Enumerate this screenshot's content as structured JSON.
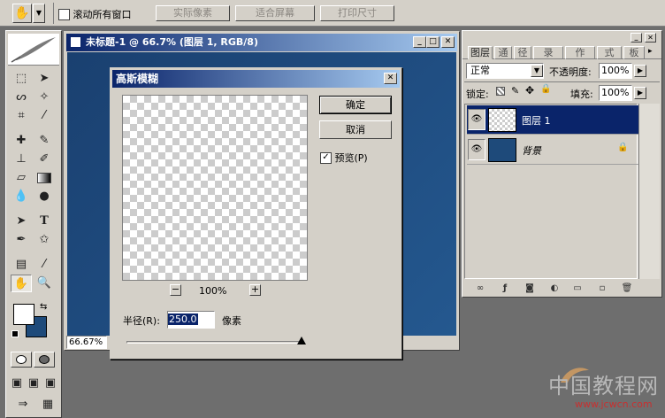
{
  "options_bar": {
    "tool_icon": "hand-icon",
    "scroll_all_windows": "滚动所有窗口",
    "actual_pixels": "实际像素",
    "fit_screen": "适合屏幕",
    "print_size": "打印尺寸"
  },
  "document": {
    "title": "未标题-1 @ 66.7% (图层 1, RGB/8)",
    "zoom_status": "66.67%"
  },
  "dialog": {
    "title": "高斯模糊",
    "ok": "确定",
    "cancel": "取消",
    "preview_label": "预览(P)",
    "preview_checked": true,
    "zoom_out": "−",
    "zoom_in": "+",
    "zoom_level": "100%",
    "radius_label": "半径(R):",
    "radius_value": "250.0",
    "radius_unit": "像素"
  },
  "layers_panel": {
    "tabs": [
      "图层",
      "通",
      "径",
      "录",
      "作",
      "式",
      "板"
    ],
    "blend_mode": "正常",
    "opacity_label": "不透明度:",
    "opacity_value": "100%",
    "lock_label": "锁定:",
    "fill_label": "填充:",
    "fill_value": "100%",
    "layers": [
      {
        "name": "图层 1",
        "selected": true
      },
      {
        "name": "背景",
        "selected": false,
        "locked": true
      }
    ]
  },
  "watermark": {
    "brand": "中国教程网",
    "url": "www.jcwcn.com"
  },
  "colors": {
    "titlebar_active": "#0a246a",
    "canvas_blue": "#1e4a7a",
    "chrome": "#d4d0c8"
  }
}
